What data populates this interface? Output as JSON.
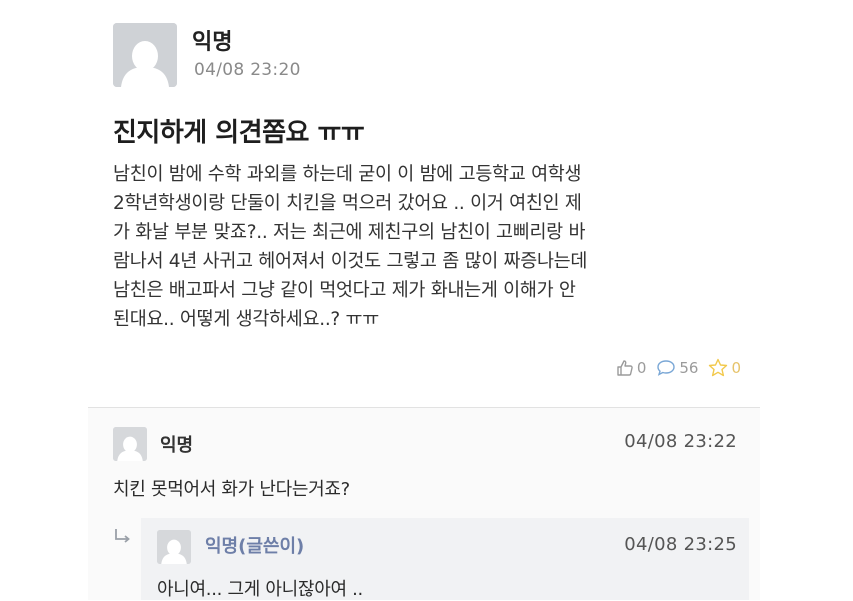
{
  "post": {
    "author": "익명",
    "time": "04/08 23:20",
    "title": "진지하게 의견쫌요 ㅠㅠ",
    "body_lines": [
      "남친이 밤에 수학 과외를 하는데 굳이 이 밤에 고등학교 여학생",
      "2학년학생이랑 단둘이 치킨을 먹으러 갔어요 .. 이거 여친인 제",
      "가 화날 부분 맞죠?.. 저는 최근에 제친구의 남친이 고삐리랑 바",
      "람나서 4년 사귀고 헤어져서 이것도 그렇고 좀 많이 짜증나는데",
      "남친은 배고파서 그냥 같이 먹엇다고 제가 화내는게 이해가 안",
      "된대요.. 어떻게 생각하세요..? ㅠㅠ"
    ],
    "reactions": {
      "likes": "0",
      "comments": "56",
      "scraps": "0"
    }
  },
  "comments": [
    {
      "author": "익명",
      "time": "04/08 23:22",
      "text": "치킨 못먹어서 화가 난다는거죠?",
      "reply": {
        "author": "익명(글쓴이)",
        "time": "04/08 23:25",
        "text": "아니여... 그게 아니잖아여 .."
      }
    }
  ],
  "colors": {
    "reply_author": "#6e7fa8",
    "scrap_star": "#f2c94c",
    "muted": "#9b9b9b"
  },
  "icons": [
    "avatar-icon",
    "like-icon",
    "comment-icon",
    "scrap-star-icon",
    "reply-arrow-icon"
  ]
}
